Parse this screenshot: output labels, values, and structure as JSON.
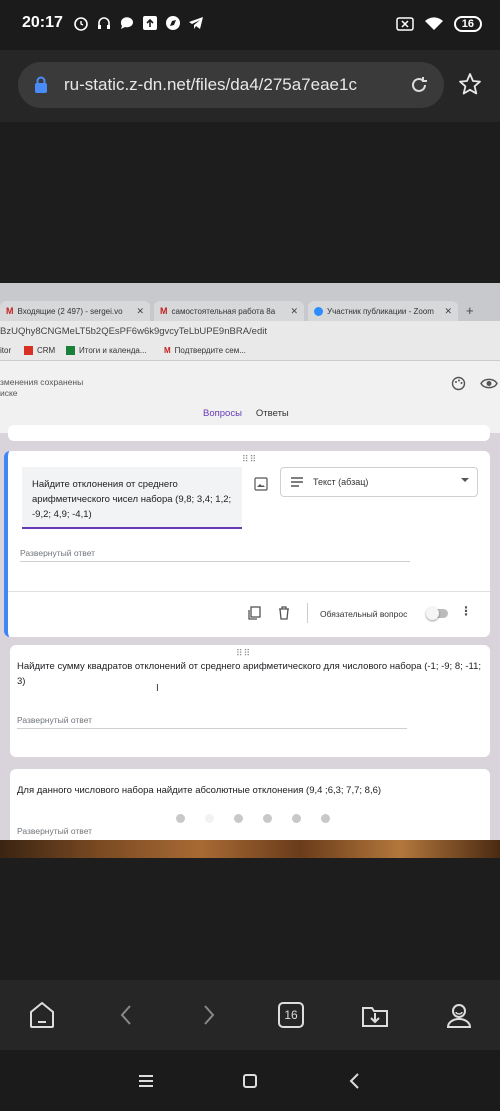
{
  "status_bar": {
    "time": "20:17",
    "battery": "16",
    "icons": [
      "alarm-icon",
      "headphones-icon",
      "chat-icon",
      "upload-icon",
      "compass-icon",
      "telegram-icon",
      "screen-x-icon",
      "wifi-icon",
      "battery-icon"
    ]
  },
  "browser": {
    "url": "ru-static.z-dn.net/files/da4/275a7eae1c",
    "reload_icon": "reload-icon",
    "star_icon": "star-icon"
  },
  "photo": {
    "tabs": [
      {
        "label": "Входящие (2 497) - sergei.vo",
        "icon": "gmail-icon"
      },
      {
        "label": "самостоятельная работа 8а",
        "icon": "gmail-icon"
      },
      {
        "label": "Участник публикации - Zoom",
        "icon": "zoom-icon"
      }
    ],
    "address": "BzUQhy8CNGMeLT5b2QEsPF6w6k9gvcyTeLbUPE9nBRA/edit",
    "bookmarks": [
      "itor",
      "CRM",
      "Итоги и календа...",
      "Подтвердите сем..."
    ],
    "saved_text_1": "зменения сохранены",
    "saved_text_2": "иске",
    "tab_questions": "Вопросы",
    "tab_answers": "Ответы",
    "q1_text": "Найдите отклонения от среднего арифметического чисел набора (9,8; 3,4; 1,2; -9,2; 4,9; -4,1)",
    "q1_type": "Текст (абзац)",
    "answer_placeholder": "Развернутый ответ",
    "required_label": "Обязательный вопрос",
    "q2_text": "Найдите сумму квадратов отклонений от среднего арифметического для числового набора (-1; -9; 8; -11; 3)",
    "q3_text": "Для данного числового набора найдите абсолютные отклонения (9,4 ;6,3; 7,7; 8,6)"
  },
  "toolbar": {
    "tab_count": "16",
    "icons": [
      "home-icon",
      "back-icon",
      "forward-icon",
      "tabs-icon",
      "download-icon",
      "profile-icon"
    ]
  },
  "colors": {
    "accent": "#673ab7",
    "highlight": "#4285f4"
  }
}
